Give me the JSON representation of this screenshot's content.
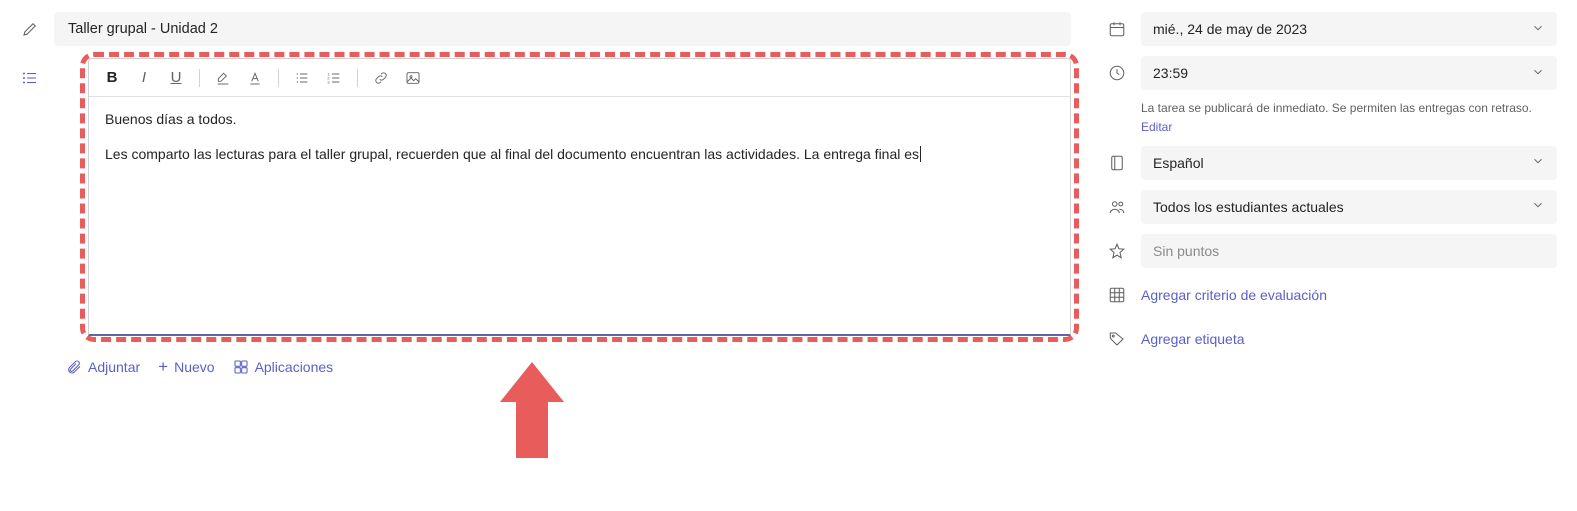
{
  "title": "Taller grupal - Unidad 2",
  "editor": {
    "line1": "Buenos días a todos.",
    "line2": "Les comparto las lecturas para el taller grupal, recuerden que al final del documento encuentran las actividades. La entrega final es"
  },
  "actions": {
    "attach": "Adjuntar",
    "new": "Nuevo",
    "apps": "Aplicaciones"
  },
  "sidebar": {
    "date": "mié., 24 de may de 2023",
    "time": "23:59",
    "note_text": "La tarea se publicará de inmediato. Se permiten las entregas con retraso.",
    "note_edit": "Editar",
    "channel": "Español",
    "students": "Todos los estudiantes actuales",
    "points": "Sin puntos",
    "rubric": "Agregar criterio de evaluación",
    "tag": "Agregar etiqueta"
  }
}
